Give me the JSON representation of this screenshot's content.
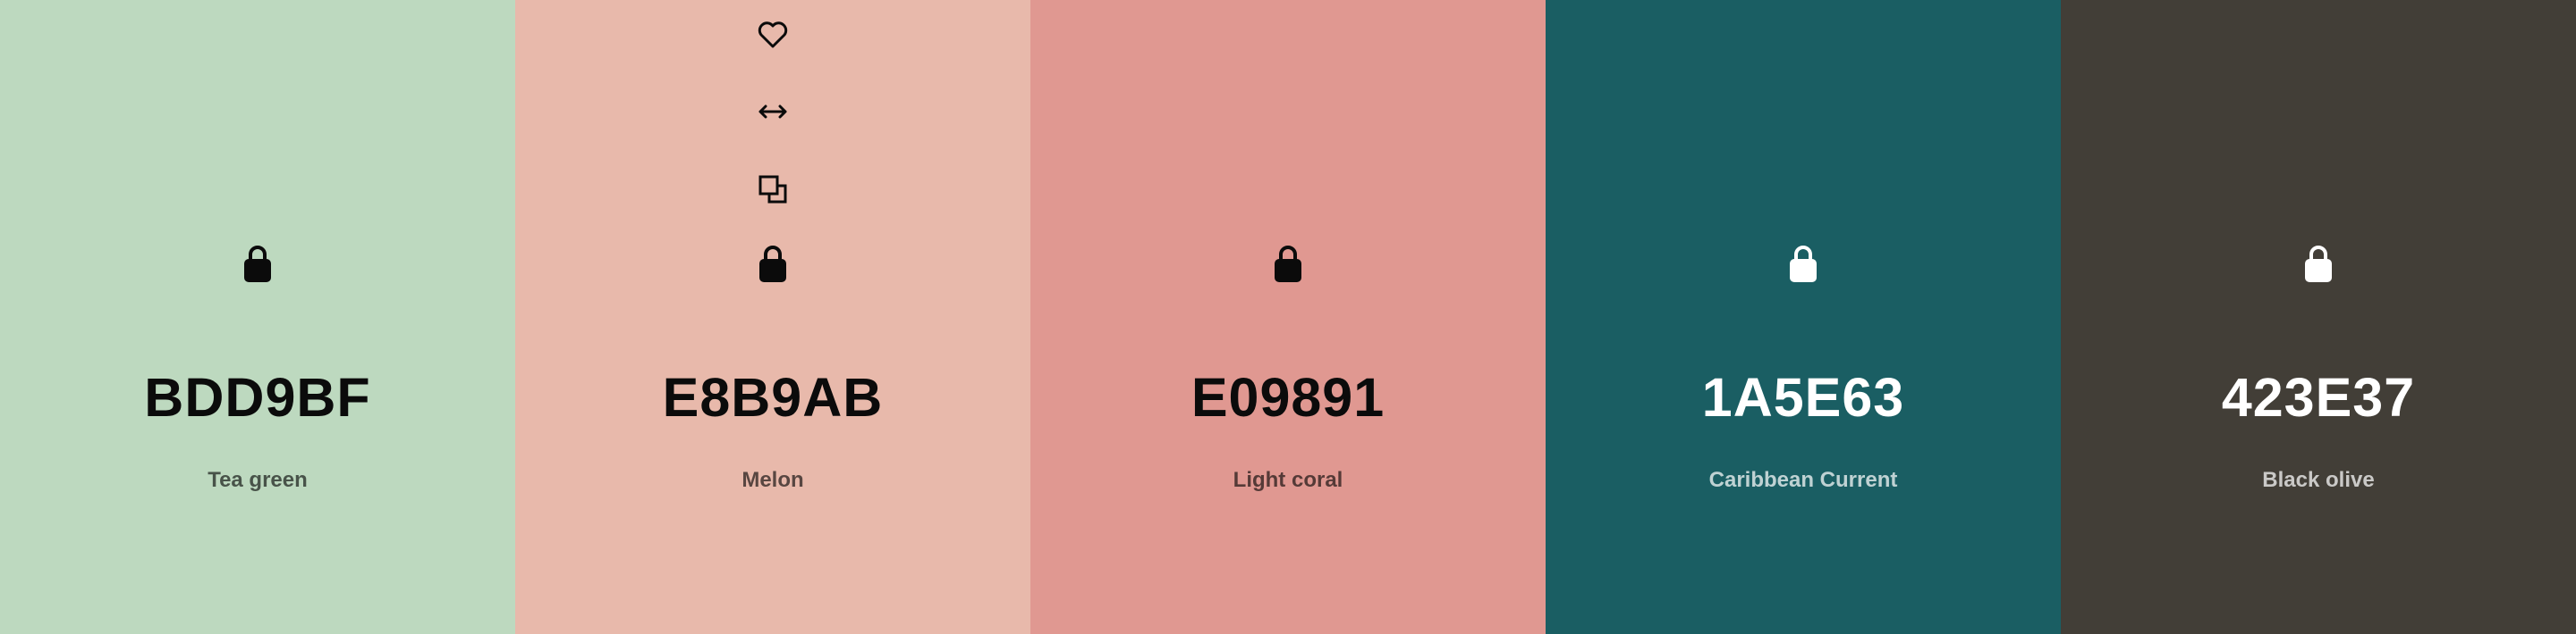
{
  "palette": {
    "swatches": [
      {
        "hex": "BDD9BF",
        "name": "Tea green",
        "color": "#BDD9BF",
        "text_tone": "dark",
        "lock_icon": "lock-icon"
      },
      {
        "hex": "E8B9AB",
        "name": "Melon",
        "color": "#E8B9AB",
        "text_tone": "dark",
        "lock_icon": "lock-icon",
        "tools": [
          "heart-icon",
          "drag-horizontal-icon",
          "copy-icon"
        ]
      },
      {
        "hex": "E09891",
        "name": "Light coral",
        "color": "#E09891",
        "text_tone": "dark",
        "lock_icon": "lock-icon"
      },
      {
        "hex": "1A5E63",
        "name": "Caribbean Current",
        "color": "#1A5E63",
        "text_tone": "light",
        "lock_icon": "lock-icon"
      },
      {
        "hex": "423E37",
        "name": "Black olive",
        "color": "#423E37",
        "text_tone": "light",
        "lock_icon": "lock-icon"
      }
    ]
  }
}
